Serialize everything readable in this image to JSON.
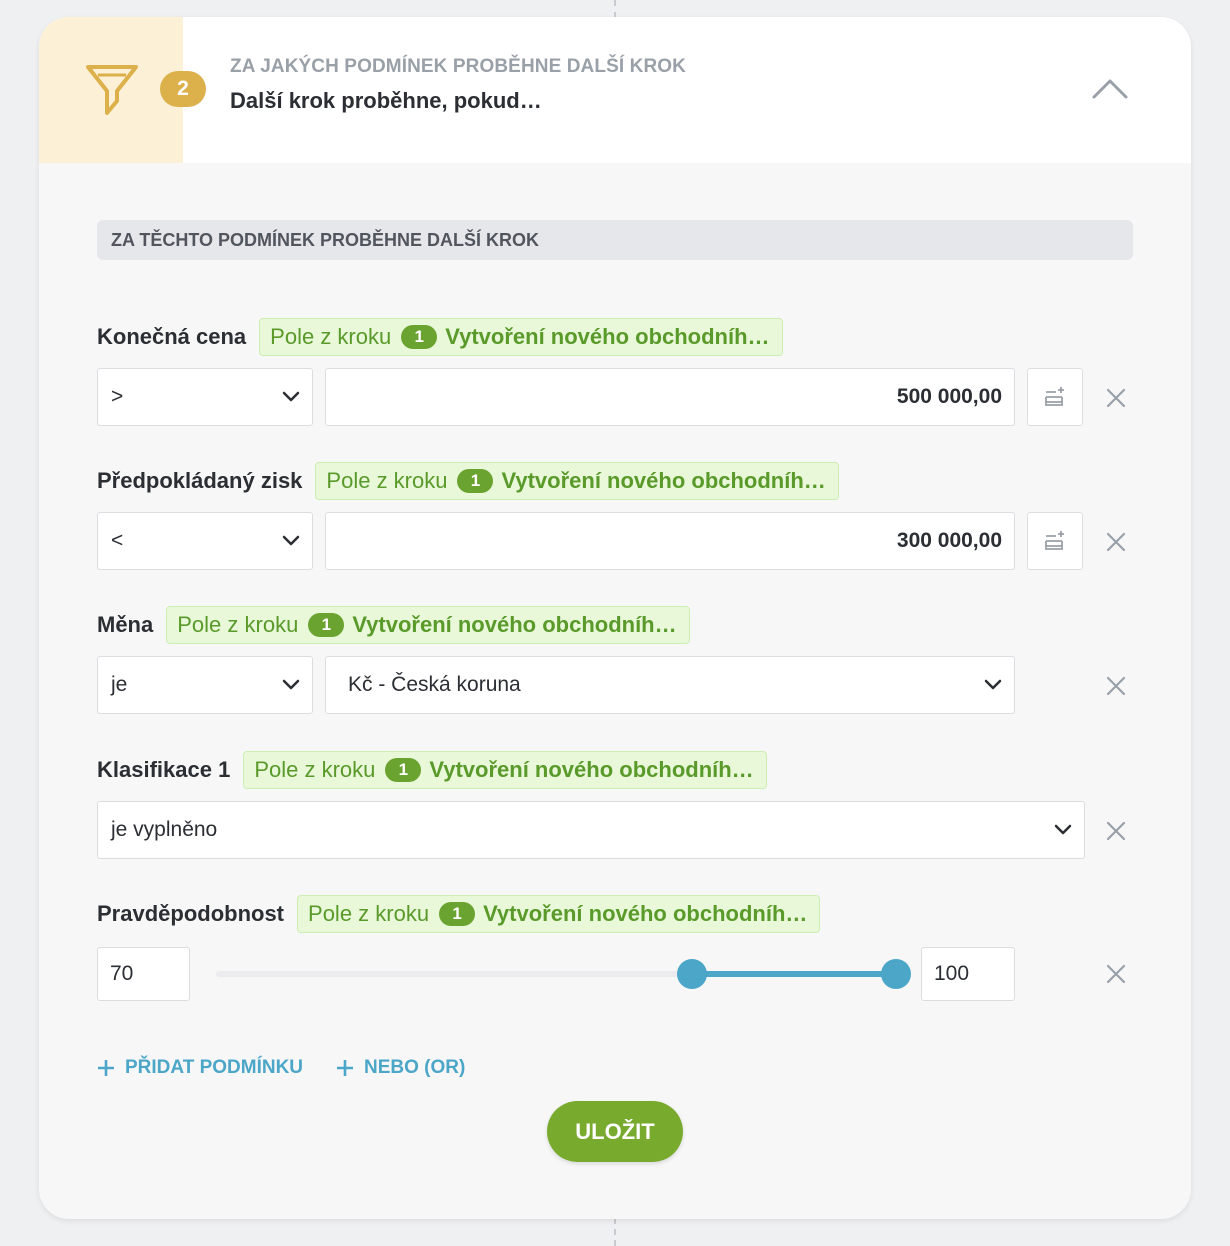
{
  "header": {
    "step_number": "2",
    "subtitle": "ZA JAKÝCH PODMÍNEK PROBĚHNE DALŠÍ KROK",
    "title": "Další krok proběhne, pokud…"
  },
  "section_title": "ZA TĚCHTO PODMÍNEK PROBĚHNE DALŠÍ KROK",
  "source_chip": {
    "prefix": "Pole z kroku",
    "step": "1",
    "name": "Vytvoření nového obchodníh…"
  },
  "conditions": [
    {
      "label": "Konečná cena",
      "operator": ">",
      "value": "500 000,00"
    },
    {
      "label": "Předpokládaný zisk",
      "operator": "<",
      "value": "300 000,00"
    },
    {
      "label": "Měna",
      "operator": "je",
      "value": "Kč - Česká koruna"
    },
    {
      "label": "Klasifikace 1",
      "operator": "je vyplněno"
    },
    {
      "label": "Pravděpodobnost",
      "min": "70",
      "max": "100",
      "range_min": 0,
      "range_max": 100
    }
  ],
  "actions": {
    "add_condition": "PŘIDAT PODMÍNKU",
    "add_or": "NEBO (OR)",
    "save": "ULOŽIT"
  },
  "colors": {
    "accent_yellow": "#dcb04a",
    "accent_green": "#78aa2d",
    "accent_blue": "#4ba6c8",
    "chip_background": "#e8f8d9"
  }
}
